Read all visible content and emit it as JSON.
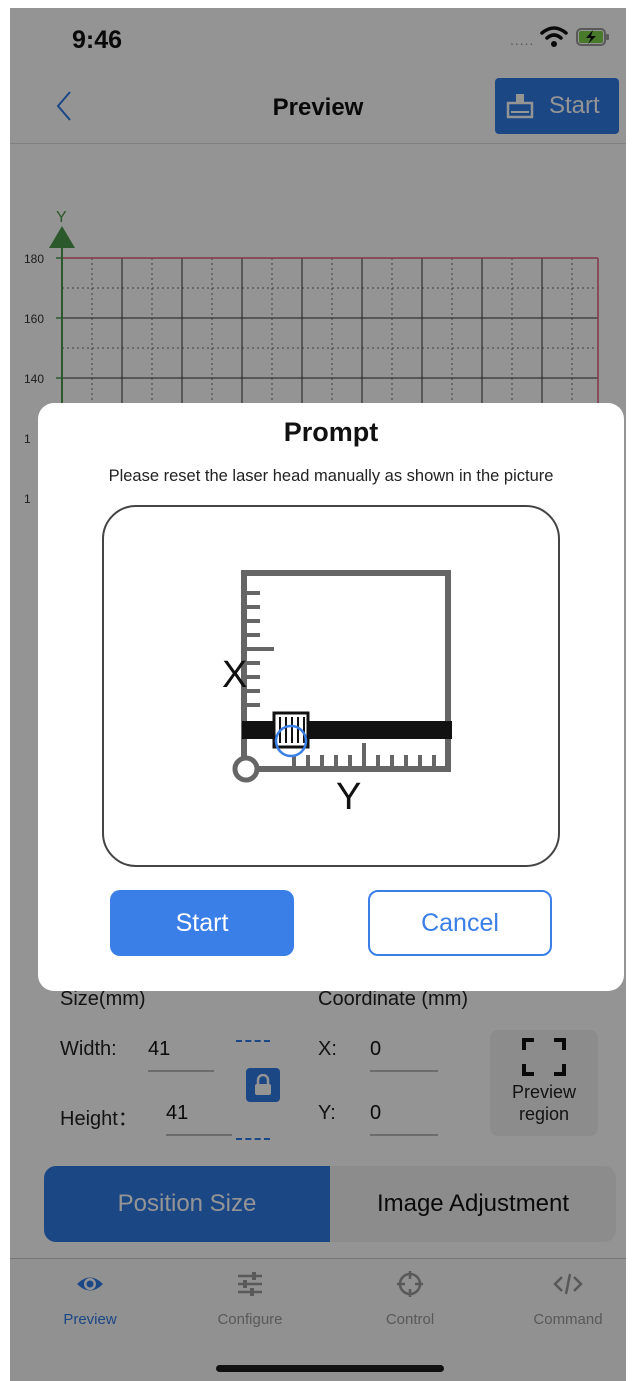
{
  "status_bar": {
    "time": "9:46",
    "signal": "....."
  },
  "nav": {
    "title": "Preview",
    "start_label": "Start"
  },
  "chart": {
    "y_axis_label": "Y",
    "y_ticks": [
      "180",
      "160",
      "140",
      "1",
      "1"
    ],
    "colors": {
      "axis": "#4a9a4a",
      "boundary": "#e06080",
      "grid": "#333333"
    }
  },
  "size_section": {
    "title": "Size(mm)",
    "width_label": "Width:",
    "width_value": "41",
    "height_label": "Height：",
    "height_value": "41"
  },
  "coordinate_section": {
    "title": "Coordinate (mm)",
    "x_label": "X:",
    "x_value": "0",
    "y_label": "Y:",
    "y_value": "0"
  },
  "preview_region": {
    "line1": "Preview",
    "line2": "region"
  },
  "segments": {
    "position_size": "Position Size",
    "image_adjustment": "Image Adjustment"
  },
  "tabs": [
    {
      "label": "Preview",
      "icon": "eye-icon",
      "active": true
    },
    {
      "label": "Configure",
      "icon": "sliders-icon",
      "active": false
    },
    {
      "label": "Control",
      "icon": "crosshair-icon",
      "active": false
    },
    {
      "label": "Command",
      "icon": "code-icon",
      "active": false
    }
  ],
  "modal": {
    "title": "Prompt",
    "message": "Please reset the laser head manually as shown in the picture",
    "diagram": {
      "x_label": "X",
      "y_label": "Y"
    },
    "start_label": "Start",
    "cancel_label": "Cancel"
  },
  "colors": {
    "accent": "#2f7ae6",
    "overlay": "rgba(0,0,0,0.42)"
  }
}
